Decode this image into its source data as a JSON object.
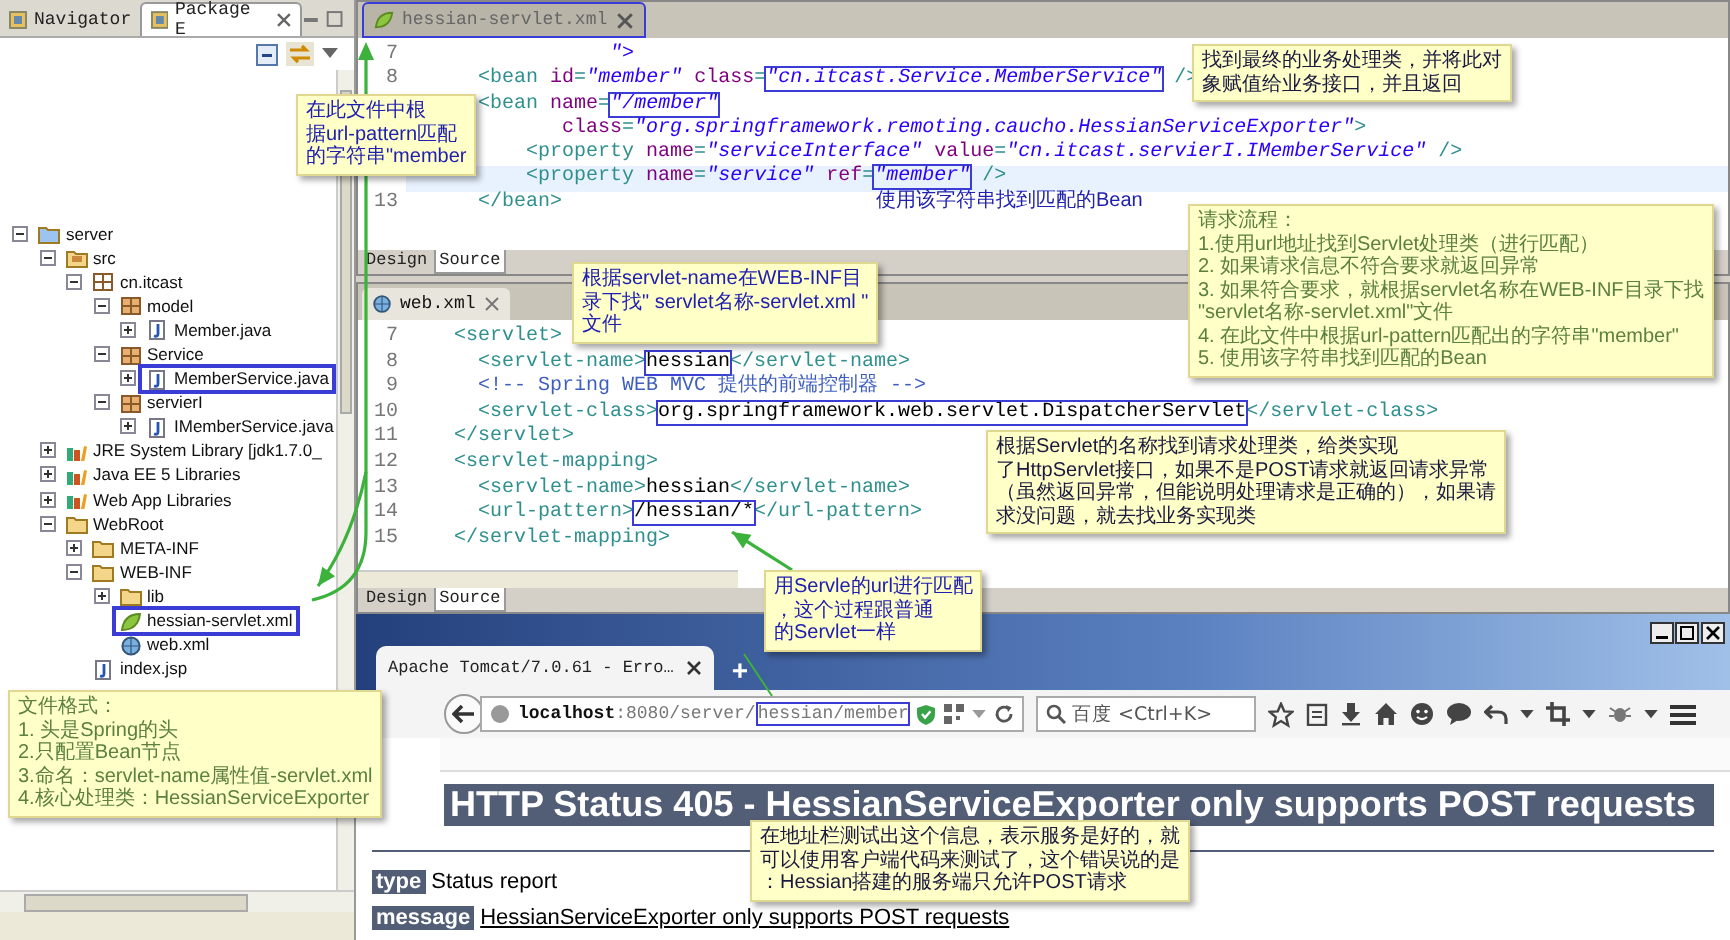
{
  "package_explorer": {
    "tabs": [
      {
        "label": "Navigator",
        "selected": false,
        "closable": false
      },
      {
        "label": "Package E",
        "selected": true,
        "closable": true
      }
    ],
    "tree": [
      {
        "label": "server",
        "kind": "project",
        "expanded": true,
        "boxed": false,
        "children": [
          {
            "label": "src",
            "kind": "source-folder",
            "expanded": true,
            "boxed": false,
            "children": [
              {
                "label": "cn.itcast",
                "kind": "package-root",
                "expanded": true,
                "boxed": false,
                "children": [
                  {
                    "label": "model",
                    "kind": "package",
                    "expanded": true,
                    "boxed": false,
                    "children": [
                      {
                        "label": "Member.java",
                        "kind": "java",
                        "expanded": false,
                        "boxed": false
                      }
                    ]
                  },
                  {
                    "label": "Service",
                    "kind": "package",
                    "expanded": true,
                    "boxed": false,
                    "children": [
                      {
                        "label": "MemberService.java",
                        "kind": "java",
                        "expanded": false,
                        "boxed": true
                      }
                    ]
                  },
                  {
                    "label": "servierI",
                    "kind": "package",
                    "expanded": true,
                    "boxed": false,
                    "children": [
                      {
                        "label": "IMemberService.java",
                        "kind": "java",
                        "expanded": false,
                        "boxed": false
                      }
                    ]
                  }
                ]
              }
            ]
          },
          {
            "label": "JRE System Library [jdk1.7.0_",
            "kind": "library",
            "expanded": false,
            "boxed": false
          },
          {
            "label": "Java EE 5 Libraries",
            "kind": "library",
            "expanded": false,
            "boxed": false
          },
          {
            "label": "Web App Libraries",
            "kind": "library",
            "expanded": false,
            "boxed": false
          },
          {
            "label": "WebRoot",
            "kind": "folder",
            "expanded": true,
            "boxed": false,
            "children": [
              {
                "label": "META-INF",
                "kind": "folder",
                "expanded": false,
                "boxed": false
              },
              {
                "label": "WEB-INF",
                "kind": "folder",
                "expanded": true,
                "boxed": false,
                "children": [
                  {
                    "label": "lib",
                    "kind": "folder",
                    "expanded": false,
                    "boxed": false
                  },
                  {
                    "label": "hessian-servlet.xml",
                    "kind": "spring-xml",
                    "boxed": true
                  },
                  {
                    "label": "web.xml",
                    "kind": "xml",
                    "boxed": false
                  }
                ]
              },
              {
                "label": "index.jsp",
                "kind": "jsp",
                "boxed": false
              }
            ]
          }
        ]
      }
    ]
  },
  "xml_editor": {
    "tab": "hessian-servlet.xml",
    "tab_boxed": true,
    "lines": [
      {
        "num": "7",
        "current": false,
        "tokens": [
          {
            "kind": "value",
            "text": "                 \">"
          }
        ]
      },
      {
        "num": "8",
        "current": false,
        "tokens": [
          {
            "kind": "tag",
            "text": "      <bean "
          },
          {
            "kind": "attr",
            "text": "id"
          },
          {
            "kind": "tag",
            "text": "="
          },
          {
            "kind": "value",
            "text": "\"member\""
          },
          {
            "kind": "attr",
            "text": " class"
          },
          {
            "kind": "tag",
            "text": "="
          },
          {
            "kind": "boxed-value",
            "text": "\"cn.itcast.Service.MemberService\""
          },
          {
            "kind": "tag",
            "text": " />"
          }
        ]
      },
      {
        "current": false,
        "tokens": [
          {
            "kind": "tag",
            "text": "      <bean "
          },
          {
            "kind": "attr",
            "text": "name"
          },
          {
            "kind": "tag",
            "text": "="
          },
          {
            "kind": "boxed-value",
            "text": "\"/member\""
          }
        ]
      },
      {
        "current": false,
        "tokens": [
          {
            "kind": "attr",
            "text": "             class"
          },
          {
            "kind": "tag",
            "text": "="
          },
          {
            "kind": "value",
            "text": "\"org.springframework.remoting.caucho.HessianServiceExporter\""
          },
          {
            "kind": "tag",
            "text": ">"
          }
        ]
      },
      {
        "current": false,
        "tokens": [
          {
            "kind": "tag",
            "text": "          <property "
          },
          {
            "kind": "attr",
            "text": "name"
          },
          {
            "kind": "tag",
            "text": "="
          },
          {
            "kind": "value",
            "text": "\"serviceInterface\""
          },
          {
            "kind": "attr",
            "text": " value"
          },
          {
            "kind": "tag",
            "text": "="
          },
          {
            "kind": "value",
            "text": "\"cn.itcast.servierI.IMemberService\""
          },
          {
            "kind": "tag",
            "text": " />"
          }
        ]
      },
      {
        "current": true,
        "tokens": [
          {
            "kind": "tag",
            "text": "          <property "
          },
          {
            "kind": "attr",
            "text": "name"
          },
          {
            "kind": "tag",
            "text": "="
          },
          {
            "kind": "value",
            "text": "\"service\""
          },
          {
            "kind": "attr",
            "text": " ref"
          },
          {
            "kind": "tag",
            "text": "="
          },
          {
            "kind": "boxed-value",
            "text": "\"member\""
          },
          {
            "kind": "tag",
            "text": " />"
          }
        ]
      },
      {
        "num": "13",
        "current": false,
        "tokens": [
          {
            "kind": "tag",
            "text": "      </bean>"
          }
        ]
      }
    ],
    "view_tabs": [
      {
        "label": "Design",
        "selected": false
      },
      {
        "label": "Source",
        "selected": true
      }
    ]
  },
  "web_editor": {
    "tab": "web.xml",
    "lines": [
      {
        "num": "7",
        "current": false,
        "tokens": [
          {
            "kind": "tag",
            "text": "    <servlet>"
          }
        ]
      },
      {
        "num": "8",
        "current": false,
        "tokens": [
          {
            "kind": "tag",
            "text": "      <servlet-name>"
          },
          {
            "kind": "boxed-text",
            "text": "hessian"
          },
          {
            "kind": "tag",
            "text": "</servlet-name>"
          }
        ]
      },
      {
        "num": "9",
        "current": false,
        "tokens": [
          {
            "kind": "comment",
            "text": "      <!-- Spring WEB MVC 提供的前端控制器 -->"
          }
        ]
      },
      {
        "num": "10",
        "current": false,
        "tokens": [
          {
            "kind": "tag",
            "text": "      <servlet-class>"
          },
          {
            "kind": "boxed-text",
            "text": "org.springframework.web.servlet.DispatcherServlet"
          },
          {
            "kind": "tag",
            "text": "</servlet-class>"
          }
        ]
      },
      {
        "num": "11",
        "current": false,
        "tokens": [
          {
            "kind": "tag",
            "text": "    </servlet>"
          }
        ]
      },
      {
        "num": "12",
        "current": false,
        "tokens": [
          {
            "kind": "tag",
            "text": "    <servlet-mapping>"
          }
        ]
      },
      {
        "num": "13",
        "current": false,
        "tokens": [
          {
            "kind": "tag",
            "text": "      <servlet-name>"
          },
          {
            "kind": "text",
            "text": "hessian"
          },
          {
            "kind": "tag",
            "text": "</servlet-name>"
          }
        ]
      },
      {
        "num": "14",
        "current": false,
        "tokens": [
          {
            "kind": "tag",
            "text": "      <url-pattern>"
          },
          {
            "kind": "boxed-text",
            "text": "/hessian/*"
          },
          {
            "kind": "tag",
            "text": "</url-pattern>"
          }
        ]
      },
      {
        "num": "15",
        "current": false,
        "tokens": [
          {
            "kind": "tag",
            "text": "    </servlet-mapping>"
          }
        ]
      }
    ],
    "view_tabs": [
      {
        "label": "Design",
        "selected": false
      },
      {
        "label": "Source",
        "selected": true
      }
    ]
  },
  "browser": {
    "tab": "Apache Tomcat/7.0.61 - Erro…",
    "new_tab": "+",
    "url": [
      {
        "kind": "host",
        "text": "localhost"
      },
      {
        "kind": "path",
        "text": ":8080/server/"
      },
      {
        "kind": "boxed",
        "text": "hessian/member"
      }
    ],
    "search": {
      "placeholder": "百度 <Ctrl+K>"
    },
    "page": {
      "heading": "HTTP Status 405 - HessianServiceExporter only supports POST requests",
      "fields": [
        {
          "label": "type",
          "value": "Status report",
          "link": false
        },
        {
          "label": "message",
          "value": "HessianServiceExporter only supports POST requests",
          "link": true
        }
      ]
    }
  },
  "notes": [
    {
      "kind": "callout",
      "lines": [
        "在此文件中根",
        "据url-pattern匹配",
        "的字符串\"member"
      ]
    },
    {
      "kind": "plain",
      "lines": [
        "找到最终的业务处理类，并将此对",
        "象赋值给业务接口，并且返回"
      ]
    },
    {
      "kind": "caption",
      "lines": [
        "使用该字符串找到匹配的Bean"
      ]
    },
    {
      "kind": "steps",
      "lines": [
        "请求流程：",
        "1.使用url地址找到Servlet处理类（进行匹配）",
        "2. 如果请求信息不符合要求就返回异常",
        "3. 如果符合要求，就根据servlet名称在WEB-INF目录下找",
        "\"servlet名称-servlet.xml\"文件",
        "4. 在此文件中根据url-pattern匹配出的字符串\"member\"",
        "5. 使用该字符串找到匹配的Bean"
      ]
    },
    {
      "kind": "callout",
      "lines": [
        "根据servlet-name在WEB-INF目",
        "录下找\" servlet名称-servlet.xml \"",
        "文件"
      ]
    },
    {
      "kind": "plain",
      "lines": [
        "根据Servlet的名称找到请求处理类，给类实现",
        "了HttpServlet接口，如果不是POST请求就返回请求异常",
        "（虽然返回异常，但能说明处理请求是正确的），如果请",
        "求没问题，就去找业务实现类"
      ]
    },
    {
      "kind": "callout",
      "lines": [
        "用Servle的url进行匹配",
        "，这个过程跟普通",
        "的Servlet一样"
      ]
    },
    {
      "kind": "steps",
      "lines": [
        "文件格式：",
        "1. 头是Spring的头",
        "2.只配置Bean节点",
        "3.命名：servlet-name属性值-servlet.xml",
        "4.核心处理类：HessianServiceExporter"
      ]
    },
    {
      "kind": "plain",
      "lines": [
        "在地址栏测试出这个信息，表示服务是好的，就",
        "可以使用客户端代码来测试了，这个错误说的是",
        "：Hessian搭建的服务端只允许POST请求"
      ]
    }
  ]
}
